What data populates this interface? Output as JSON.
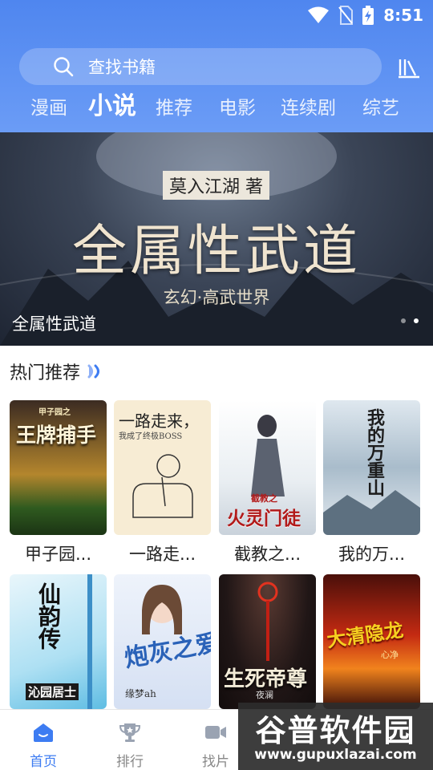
{
  "status_bar": {
    "time": "8:51"
  },
  "search": {
    "placeholder": "查找书籍",
    "icon": "search-icon",
    "shelf_icon": "bookshelf-icon"
  },
  "tabs": [
    {
      "label": "漫画",
      "active": false
    },
    {
      "label": "小说",
      "active": true
    },
    {
      "label": "推荐",
      "active": false
    },
    {
      "label": "电影",
      "active": false
    },
    {
      "label": "连续剧",
      "active": false
    },
    {
      "label": "综艺",
      "active": false
    }
  ],
  "banner": {
    "author_tag": "莫入江湖 著",
    "big_title": "全属性武道",
    "genre": "玄幻·高武世界",
    "caption": "全属性武道",
    "slides": 2,
    "active_slide": 2
  },
  "section": {
    "title": "热门推荐"
  },
  "books": [
    {
      "title": "甲子园...",
      "cover_text": "王牌捕手",
      "cover_sub": "甲子园之"
    },
    {
      "title": "一路走...",
      "cover_text": "一路走来，",
      "cover_sub": "我成了终极BOSS"
    },
    {
      "title": "截教之...",
      "cover_text": "火灵门徒",
      "cover_sub": "截教之"
    },
    {
      "title": "我的万...",
      "cover_text": "我的万重山",
      "cover_sub": ""
    },
    {
      "title": "",
      "cover_text": "仙韵传",
      "cover_sub": "沁园居士"
    },
    {
      "title": "",
      "cover_text": "炮灰之爱",
      "cover_sub": "缘梦ah"
    },
    {
      "title": "",
      "cover_text": "生死帝尊",
      "cover_sub": "夜澜"
    },
    {
      "title": "",
      "cover_text": "大清隐龙",
      "cover_sub": "心净"
    }
  ],
  "bottom_nav": [
    {
      "label": "首页",
      "icon": "home-icon",
      "active": true
    },
    {
      "label": "排行",
      "icon": "trophy-icon",
      "active": false
    },
    {
      "label": "找片",
      "icon": "video-camera-icon",
      "active": false
    }
  ],
  "watermark": {
    "title": "谷普软件园",
    "url": "www.gupuxlazai.com"
  },
  "colors": {
    "primary": "#4f86ef",
    "active_nav": "#3d7cf2"
  }
}
